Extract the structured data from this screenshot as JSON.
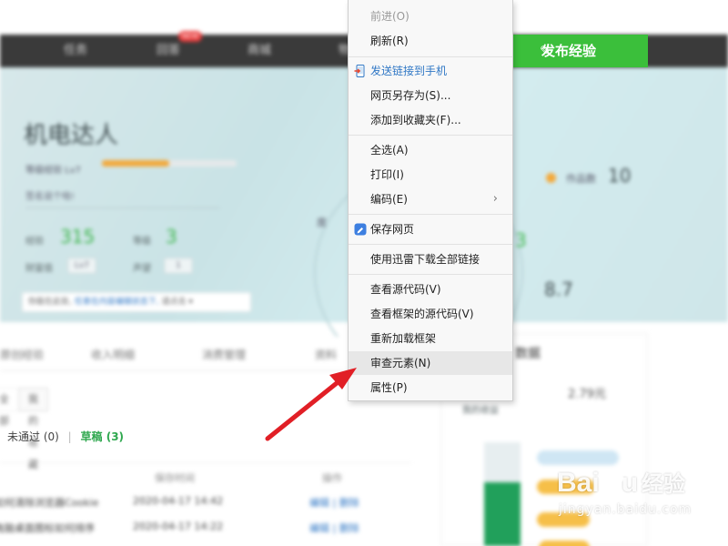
{
  "context_menu": {
    "items": [
      {
        "label": "前进(O)",
        "disabled": true
      },
      {
        "label": "刷新(R)"
      },
      {
        "label": "发送链接到手机",
        "icon": "phone-send-icon"
      },
      {
        "label": "网页另存为(S)..."
      },
      {
        "label": "添加到收藏夹(F)..."
      },
      {
        "label": "全选(A)"
      },
      {
        "label": "打印(I)"
      },
      {
        "label": "编码(E)",
        "submenu": true
      },
      {
        "label": "保存网页",
        "icon": "save-page-icon"
      },
      {
        "label": "使用迅雷下载全部链接"
      },
      {
        "label": "查看源代码(V)"
      },
      {
        "label": "查看框架的源代码(V)"
      },
      {
        "label": "重新加载框架"
      },
      {
        "label": "审查元素(N)",
        "highlighted": true
      },
      {
        "label": "属性(P)"
      }
    ],
    "submenu_glyph": "›"
  },
  "page": {
    "nav": {
      "items": [
        "任务",
        "回答",
        "商城",
        "物"
      ],
      "badge": "NEW"
    },
    "publish_button": "发布经验",
    "publish_icon_glyph": "✎",
    "hero": {
      "title": "机电达人",
      "level_text": "等级经验 Lv7",
      "progress": 0.5,
      "sub_text": "签名说个啥!",
      "stats": [
        {
          "label": "经验",
          "value": "315"
        },
        {
          "label": "等级",
          "value": "3"
        }
      ],
      "row2": [
        {
          "label": "财富值",
          "value": "Lv7"
        },
        {
          "label": "声望",
          "value": "1"
        }
      ],
      "right_label": "作品数",
      "right_value": "10",
      "right_value2": "8.7",
      "circle_label": "度",
      "circle_value": "3"
    },
    "notice": {
      "text": "你能在此处,",
      "link": "任意在内容编辑状态下,",
      "tail": "请点击 ▾"
    },
    "tabs": [
      "原创经验",
      "收入明细",
      "消费管理",
      "资料"
    ],
    "subtabs": [
      "全部",
      "我的收藏"
    ],
    "status": {
      "rejected": "未通过 (0)",
      "draft": "草稿 (3)"
    },
    "table": {
      "headers": [
        "保存时间",
        "操作"
      ],
      "rows": [
        {
          "title": "如何清除浏览器Cookie",
          "time": "2020-04-17 14:42",
          "action": "编辑 | 删除"
        },
        {
          "title": "电脑桌面图标如何排序",
          "time": "2020-04-17 14:22",
          "action": "编辑 | 删除"
        }
      ]
    },
    "right_panel": {
      "title": "数据",
      "value": "2.79元",
      "caption": "我的收益"
    }
  },
  "watermark": {
    "brand": "Bai",
    "brand_tail": "u",
    "cn": "经验",
    "url": "jingyan.baidu.com"
  },
  "colors": {
    "accent_green": "#3bbf3b",
    "arrow_red": "#e11f26",
    "link_blue": "#2f77c5",
    "highlight": "#e7e7e7"
  }
}
